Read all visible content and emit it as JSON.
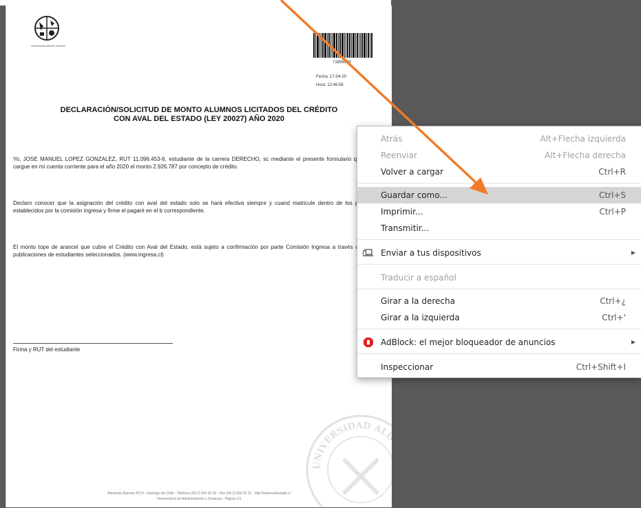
{
  "document": {
    "logo_caption": "Universidad Alberto Hurtado",
    "barcode_number": "71898509",
    "fecha": "Fecha: 17-04-20",
    "hora": "Hora: 12:46:56",
    "title_line1": "DECLARACIÓN/SOLICITUD DE MONTO ALUMNOS LICITADOS DEL CRÉDITO",
    "title_line2": "CON AVAL DEL ESTADO (LEY 20027) AÑO 2020",
    "paragraph1": "Yo, JOSE MANUEL LOPEZ GONZALEZ, RUT 11.096.453-6, estudiante de la carrera DERECHO, sc mediante el presente formulario que se cargue en mi cuenta corriente  para el año 2020 el monto 2.926.787 por concepto de crédito.",
    "paragraph2": "Declaro conocer que la asignación del crédito con aval del estado solo se hará efectiva siempre y cuand matricule dentro de los plazos establecidos por la comisión ingresa y firme el pagaré en el b correspondiente.",
    "paragraph3": "El monto tope de arancel que cubre el Crédito con Aval del Estado, está sujeto a confirmación por parte Comisión Ingresa a través de las publicaciones de estudiantes seleccionados. (www.ingresa.cl)",
    "signature_label": "Firma y RUT del estudiante",
    "footer_line1": "Almirante Barroso N°10 - Santiago de Chile - Teléfono (56-2) 692 02 00 - Fax (56-2) 692 02 31 - http://www.uahurtado.cl",
    "footer_line2": "Vicerrectoría de Administración y Finanzas - Página 1/1",
    "seal_text": "UNIVERSIDAD ALBERTO HURTADO"
  },
  "context_menu": {
    "items": [
      {
        "label": "Atrás",
        "shortcut": "Alt+Flecha izquierda",
        "disabled": true
      },
      {
        "label": "Reenviar",
        "shortcut": "Alt+Flecha derecha",
        "disabled": true
      },
      {
        "label": "Volver a cargar",
        "shortcut": "Ctrl+R"
      },
      {
        "label": "Guardar como...",
        "shortcut": "Ctrl+S",
        "highlighted": true
      },
      {
        "label": "Imprimir...",
        "shortcut": "Ctrl+P"
      },
      {
        "label": "Transmitir..."
      },
      {
        "label": "Enviar a tus dispositivos",
        "submenu": true,
        "icon": "laptop-icon"
      },
      {
        "label": "Traducir a español",
        "disabled": true
      },
      {
        "label": "Girar a la derecha",
        "shortcut": "Ctrl+¿"
      },
      {
        "label": "Girar a la izquierda",
        "shortcut": "Ctrl+'"
      },
      {
        "label": "AdBlock: el mejor bloqueador de anuncios",
        "submenu": true,
        "icon": "adblock-icon"
      },
      {
        "label": "Inspeccionar",
        "shortcut": "Ctrl+Shift+I"
      }
    ]
  },
  "colors": {
    "viewer_background": "#595959",
    "menu_highlight": "#d5d5d5",
    "arrow": "#f07b2a",
    "adblock_red": "#e02020"
  },
  "icons": {
    "submenu_arrow": "▶"
  }
}
